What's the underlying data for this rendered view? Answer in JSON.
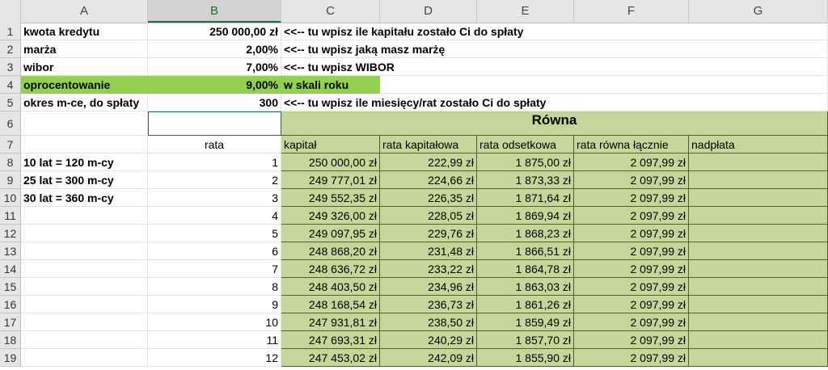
{
  "columns": [
    "A",
    "B",
    "C",
    "D",
    "E",
    "F",
    "G"
  ],
  "rows_numbers": [
    "1",
    "2",
    "3",
    "4",
    "5",
    "6",
    "7",
    "8",
    "9",
    "10",
    "11",
    "12",
    "13",
    "14",
    "15",
    "16",
    "17",
    "18",
    "19"
  ],
  "inputs": [
    {
      "label": "kwota kredytu",
      "value": "250 000,00 zł",
      "note": "<<-- tu wpisz ile kapitału zostało Ci do spłaty"
    },
    {
      "label": "marża",
      "value": "2,00%",
      "note": "<<-- tu wpisz jaką masz marżę"
    },
    {
      "label": "wibor",
      "value": "7,00%",
      "note": "<<-- tu wpisz WIBOR"
    },
    {
      "label": "oprocentowanie",
      "value": "9,00%",
      "note": "w skali roku"
    },
    {
      "label": "okres m-ce,  do spłaty",
      "value": "300",
      "note": "<<-- tu wpisz ile miesięcy/rat zostało Ci do spłaty"
    }
  ],
  "table": {
    "title": "Równa",
    "rata_header": "rata",
    "headers": [
      "kapitał",
      "rata kapitałowa",
      "rata odsetkowa",
      "rata  równa łącznie",
      "nadpłata"
    ],
    "notes": [
      "10 lat = 120 m-cy",
      "25 lat = 300 m-cy",
      "30 lat = 360 m-cy"
    ],
    "rows": [
      {
        "n": "1",
        "kapital": "250 000,00 zł",
        "kap": "222,99 zł",
        "ods": "1 875,00 zł",
        "laczna": "2 097,99 zł"
      },
      {
        "n": "2",
        "kapital": "249 777,01 zł",
        "kap": "224,66 zł",
        "ods": "1 873,33 zł",
        "laczna": "2 097,99 zł"
      },
      {
        "n": "3",
        "kapital": "249 552,35 zł",
        "kap": "226,35 zł",
        "ods": "1 871,64 zł",
        "laczna": "2 097,99 zł"
      },
      {
        "n": "4",
        "kapital": "249 326,00 zł",
        "kap": "228,05 zł",
        "ods": "1 869,94 zł",
        "laczna": "2 097,99 zł"
      },
      {
        "n": "5",
        "kapital": "249 097,95 zł",
        "kap": "229,76 zł",
        "ods": "1 868,23 zł",
        "laczna": "2 097,99 zł"
      },
      {
        "n": "6",
        "kapital": "248 868,20 zł",
        "kap": "231,48 zł",
        "ods": "1 866,51 zł",
        "laczna": "2 097,99 zł"
      },
      {
        "n": "7",
        "kapital": "248 636,72 zł",
        "kap": "233,22 zł",
        "ods": "1 864,78 zł",
        "laczna": "2 097,99 zł"
      },
      {
        "n": "8",
        "kapital": "248 403,50 zł",
        "kap": "234,96 zł",
        "ods": "1 863,03 zł",
        "laczna": "2 097,99 zł"
      },
      {
        "n": "9",
        "kapital": "248 168,54 zł",
        "kap": "236,73 zł",
        "ods": "1 861,26 zł",
        "laczna": "2 097,99 zł"
      },
      {
        "n": "10",
        "kapital": "247 931,81 zł",
        "kap": "238,50 zł",
        "ods": "1 859,49 zł",
        "laczna": "2 097,99 zł"
      },
      {
        "n": "11",
        "kapital": "247 693,31 zł",
        "kap": "240,29 zł",
        "ods": "1 857,70 zł",
        "laczna": "2 097,99 zł"
      },
      {
        "n": "12",
        "kapital": "247 453,02 zł",
        "kap": "242,09 zł",
        "ods": "1 855,90 zł",
        "laczna": "2 097,99 zł"
      }
    ]
  },
  "colors": {
    "highlight_green": "#92d050",
    "table_olive": "#c4d79b",
    "header_gray": "#e6e6e6"
  }
}
